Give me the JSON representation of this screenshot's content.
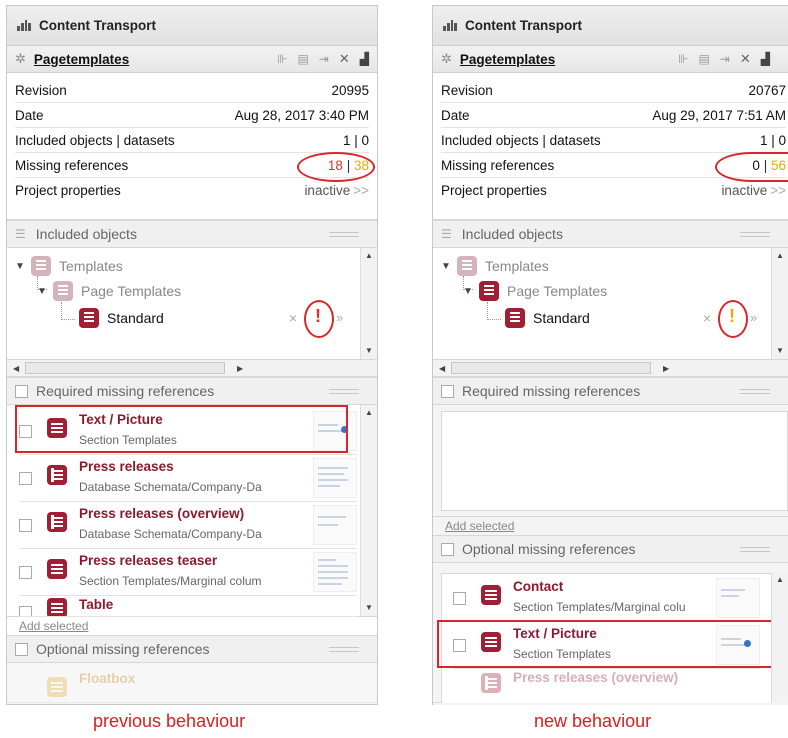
{
  "left": {
    "title": "Content Transport",
    "toolbar_title": "Pagetemplates",
    "props": [
      {
        "label": "Revision",
        "value": "20995"
      },
      {
        "label": "Date",
        "value": "Aug 28, 2017 3:40 PM"
      },
      {
        "label": "Included objects | datasets",
        "value": "1 | 0"
      },
      {
        "label": "Missing references",
        "value_a": "18",
        "value_b": "38"
      },
      {
        "label": "Project properties",
        "value": "inactive",
        "chevron": ">>"
      }
    ],
    "included_objects_label": "Included objects",
    "tree": {
      "root": "Templates",
      "folder": "Page Templates",
      "leaf": "Standard",
      "status": "!"
    },
    "required_label": "Required missing references",
    "required_items": [
      {
        "title": "Text / Picture",
        "sub": "Section Templates"
      },
      {
        "title": "Press releases",
        "sub": "Database Schemata/Company-Da"
      },
      {
        "title": "Press releases (overview)",
        "sub": "Database Schemata/Company-Da"
      },
      {
        "title": "Press releases teaser",
        "sub": "Section Templates/Marginal colum"
      },
      {
        "title": "Table",
        "sub": ""
      }
    ],
    "add_selected": "Add selected",
    "optional_label": "Optional missing references",
    "optional_items": [
      {
        "title": "Floatbox",
        "sub": ""
      }
    ]
  },
  "right": {
    "title": "Content Transport",
    "toolbar_title": "Pagetemplates",
    "props": [
      {
        "label": "Revision",
        "value": "20767"
      },
      {
        "label": "Date",
        "value": "Aug 29, 2017 7:51 AM"
      },
      {
        "label": "Included objects | datasets",
        "value": "1 | 0"
      },
      {
        "label": "Missing references",
        "value_a": "0",
        "value_b": "56"
      },
      {
        "label": "Project properties",
        "value": "inactive",
        "chevron": ">>"
      }
    ],
    "included_objects_label": "Included objects",
    "tree": {
      "root": "Templates",
      "folder": "Page Templates",
      "leaf": "Standard",
      "status": "!"
    },
    "required_label": "Required missing references",
    "add_selected": "Add selected",
    "optional_label": "Optional missing references",
    "optional_items": [
      {
        "title": "Contact",
        "sub": "Section Templates/Marginal colu"
      },
      {
        "title": "Text / Picture",
        "sub": "Section Templates"
      },
      {
        "title": "Press releases (overview)",
        "sub": ""
      }
    ]
  },
  "captions": {
    "left": "previous behaviour",
    "right": "new behaviour"
  },
  "colors": {
    "accent_red": "#e0302a",
    "warning_orange": "#f2a800",
    "icon_crimson": "#a11e34"
  },
  "icons": {
    "window": "bar-chart-icon",
    "toolbar_left": "gear-icon",
    "status": "exclamation-icon"
  }
}
